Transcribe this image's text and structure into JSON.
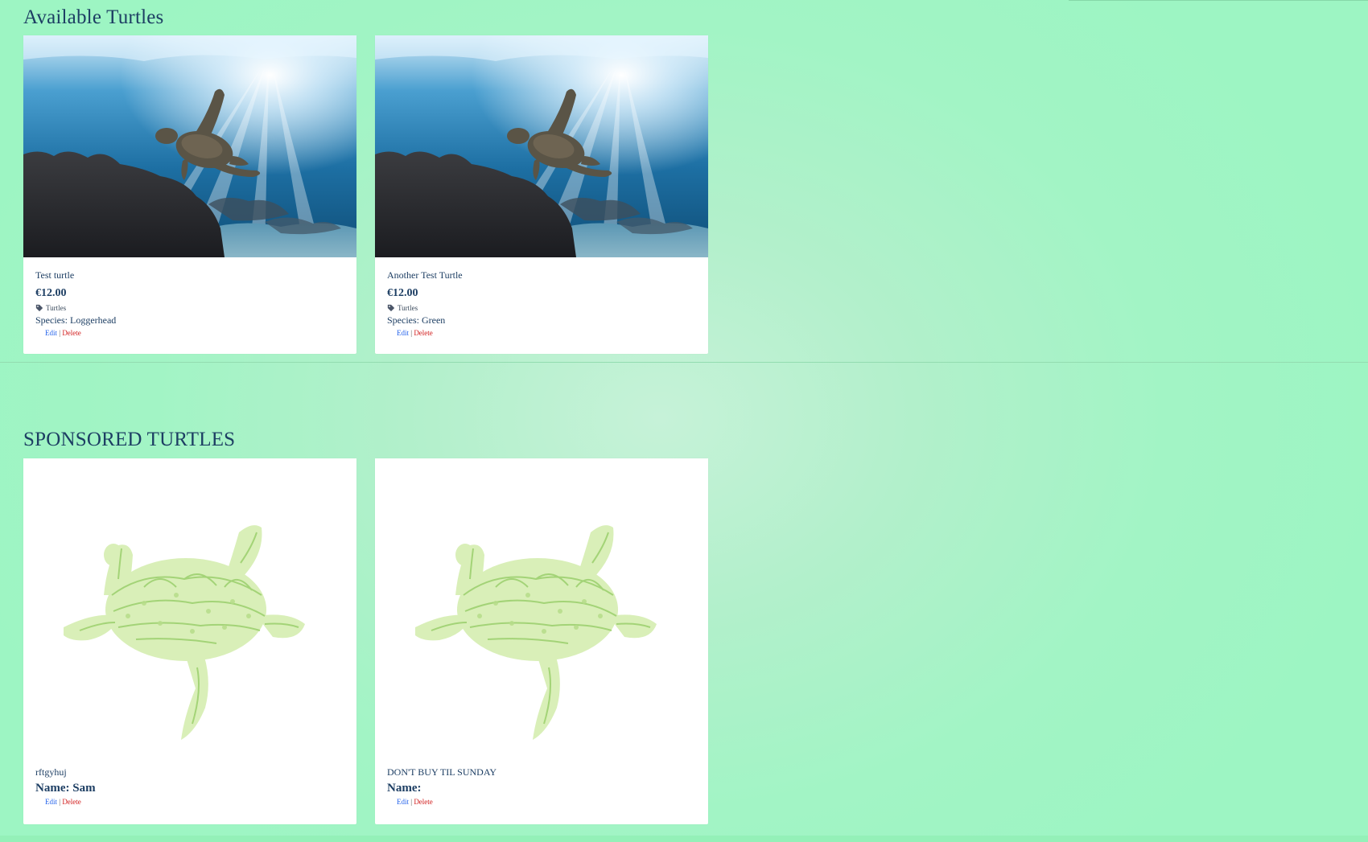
{
  "available": {
    "title": "Available Turtles",
    "items": [
      {
        "name": "Test turtle",
        "price": "€12.00",
        "category": "Turtles",
        "species": "Species: Loggerhead",
        "edit": "Edit",
        "sep": "|",
        "delete": "Delete"
      },
      {
        "name": "Another Test Turtle",
        "price": "€12.00",
        "category": "Turtles",
        "species": "Species: Green",
        "edit": "Edit",
        "sep": "|",
        "delete": "Delete"
      }
    ]
  },
  "sponsored": {
    "title": "SPONSORED TURTLES",
    "items": [
      {
        "description": "rftgyhuj",
        "name_line": "Name: Sam",
        "edit": "Edit",
        "sep": "|",
        "delete": "Delete"
      },
      {
        "description": "DON'T BUY TIL SUNDAY",
        "name_line": "Name:",
        "edit": "Edit",
        "sep": "|",
        "delete": "Delete"
      }
    ]
  },
  "icons": {
    "tag": "tag-icon",
    "photo": "sea-turtle-photo",
    "wordart": "turtle-word-cloud"
  },
  "colors": {
    "background": "#a2f4c5",
    "heading": "#1d3e63",
    "edit_link": "#2563eb",
    "delete_link": "#d11c1c",
    "card": "#ffffff"
  }
}
